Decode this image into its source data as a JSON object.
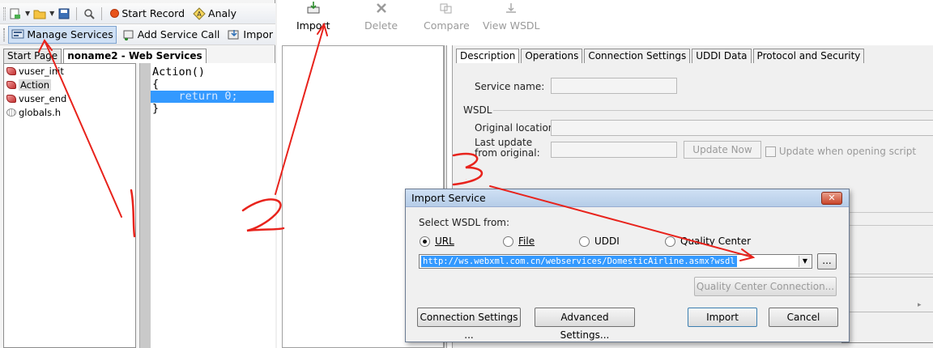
{
  "ide": {
    "toolbar1": {
      "start_record": "Start Record",
      "analyze": "Analy"
    },
    "toolbar2": {
      "manage_services": "Manage Services",
      "add_service_call": "Add Service Call",
      "import": "Impor"
    },
    "tabs": [
      {
        "label": "Start Page"
      },
      {
        "label": "noname2 - Web Services"
      }
    ],
    "tree": [
      {
        "label": "vuser_init"
      },
      {
        "label": "Action"
      },
      {
        "label": "vuser_end"
      },
      {
        "label": "globals.h"
      }
    ],
    "code": [
      "Action()",
      "{",
      "    return 0;",
      "}"
    ]
  },
  "wsdl": {
    "toolbar": {
      "import": "Import",
      "delete": "Delete",
      "compare": "Compare",
      "view_wsdl": "View WSDL"
    },
    "tabs": [
      {
        "label": "Description"
      },
      {
        "label": "Operations"
      },
      {
        "label": "Connection Settings"
      },
      {
        "label": "UDDI Data"
      },
      {
        "label": "Protocol and Security"
      }
    ],
    "service_name_label": "Service name:",
    "wsdl_group": "WSDL",
    "original_location_label": "Original location:",
    "last_update_label_1": "Last update",
    "last_update_label_2": "from original:",
    "update_now": "Update Now",
    "update_when_opening": "Update when opening script"
  },
  "dialog": {
    "title": "Import Service",
    "close": "✕",
    "select_label": "Select WSDL from:",
    "options": [
      {
        "label": "URL",
        "selected": true
      },
      {
        "label": "File"
      },
      {
        "label": "UDDI"
      },
      {
        "label": "Quality Center"
      }
    ],
    "url_value": "http://ws.webxml.com.cn/webservices/DomesticAirline.asmx?wsdl",
    "browse": "...",
    "qc_connection": "Quality Center Connection...",
    "connection_settings": "Connection Settings ...",
    "advanced_settings": "Advanced Settings...",
    "import": "Import",
    "cancel": "Cancel"
  },
  "annotations": {
    "step1": "1",
    "step2": "2",
    "step3": "3"
  },
  "colors": {
    "annotation": "#e8231c",
    "selection": "#3399ff",
    "dialog_title": "#b6cde8"
  }
}
